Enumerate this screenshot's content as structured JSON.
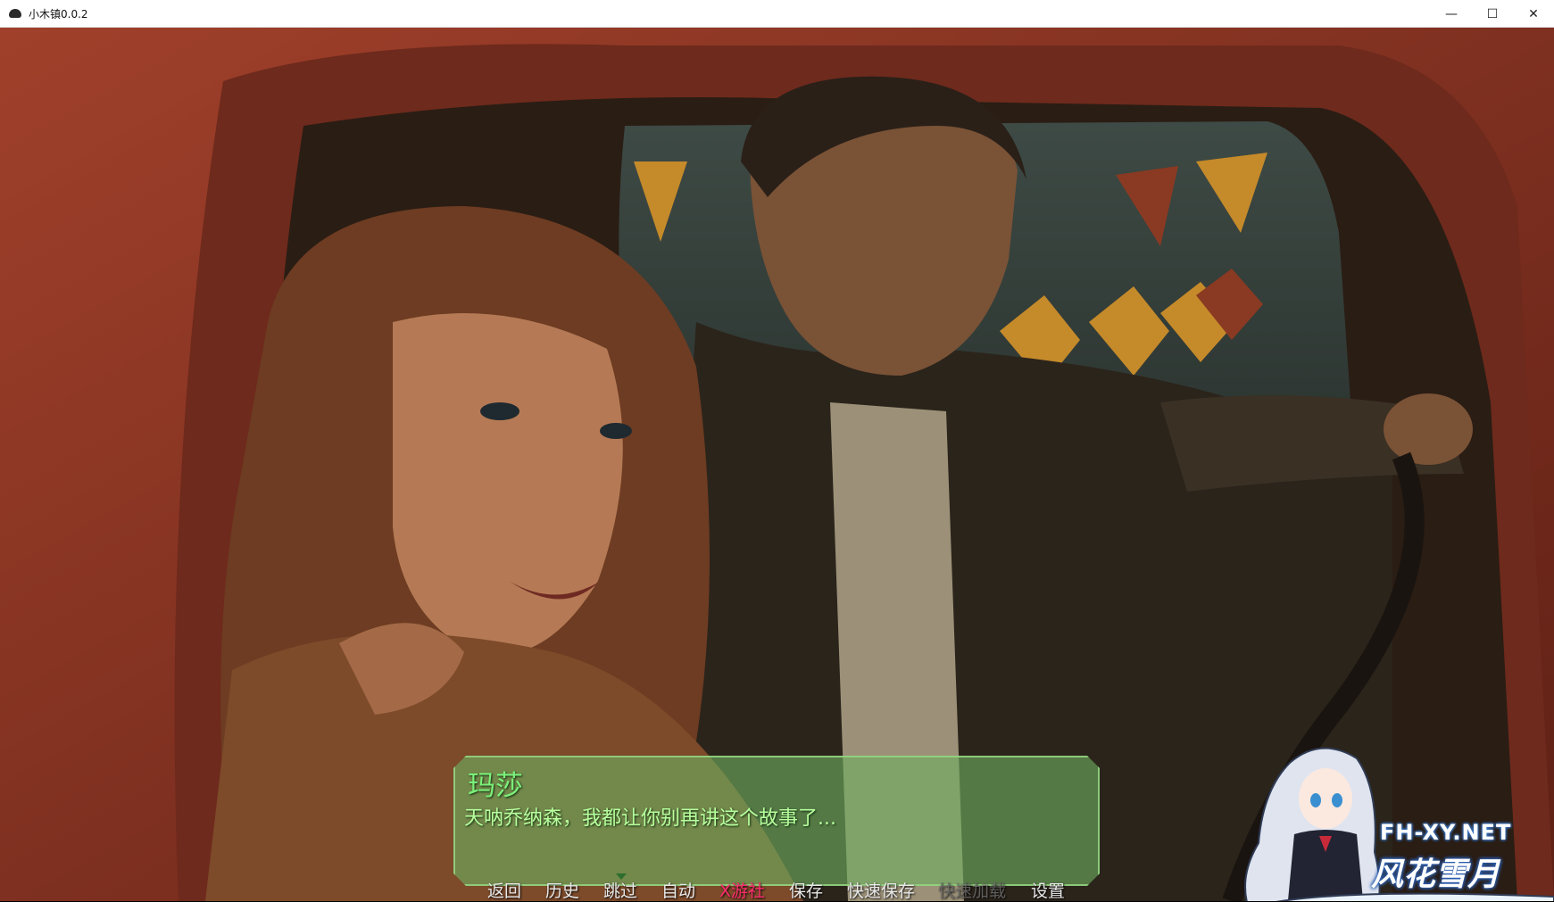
{
  "window": {
    "title": "小木镇0.0.2",
    "controls": {
      "minimize": "—",
      "maximize": "☐",
      "close": "✕"
    }
  },
  "dialogue": {
    "speaker": "玛莎",
    "text": "天呐乔纳森，我都让你别再讲这个故事了..."
  },
  "quick_menu": [
    {
      "label": "返回",
      "state": "normal"
    },
    {
      "label": "历史",
      "state": "normal"
    },
    {
      "label": "跳过",
      "state": "normal"
    },
    {
      "label": "自动",
      "state": "normal"
    },
    {
      "label": "X游社",
      "state": "accent"
    },
    {
      "label": "保存",
      "state": "normal"
    },
    {
      "label": "快速保存",
      "state": "normal"
    },
    {
      "label": "快速加载",
      "state": "disabled"
    },
    {
      "label": "设置",
      "state": "normal"
    }
  ],
  "watermark": {
    "url": "FH-XY.NET",
    "name": "风花雪月"
  },
  "colors": {
    "dialogue_name": "#7cf07a",
    "dialogue_text": "#b8ff9e",
    "accent_menu": "#ff2d6e",
    "car_red": "#8f3322"
  }
}
